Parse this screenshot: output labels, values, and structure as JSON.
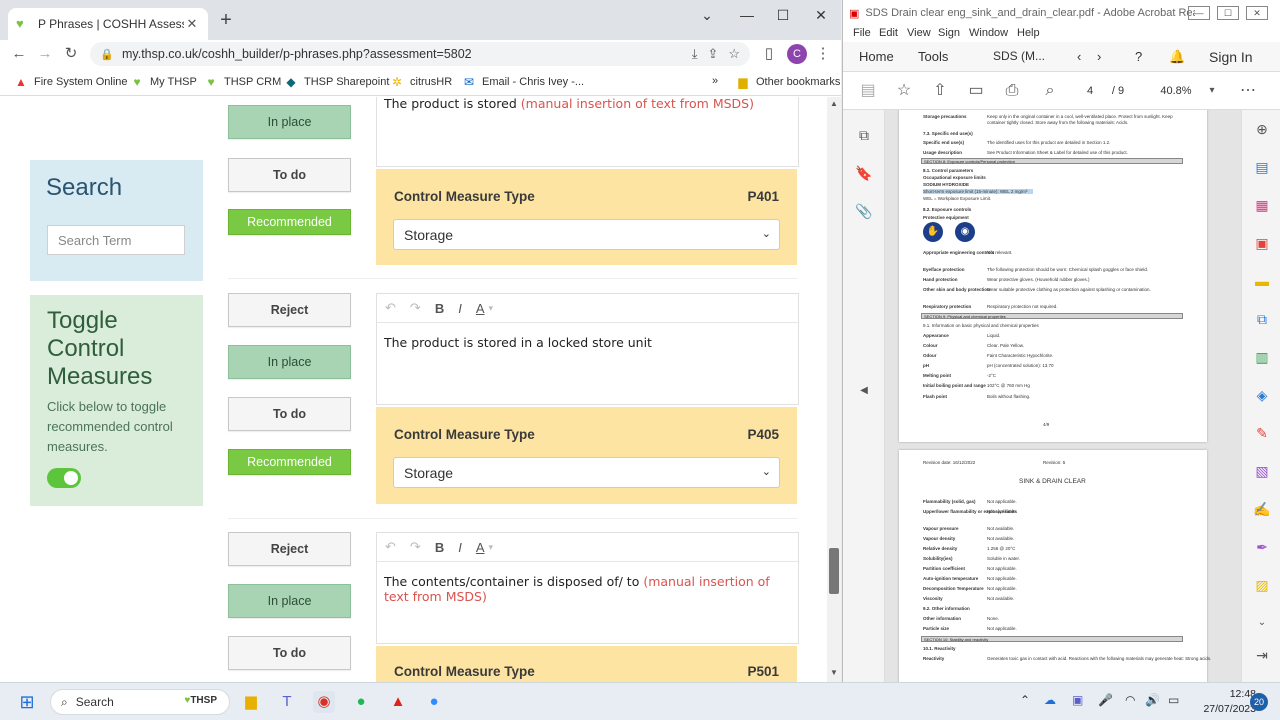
{
  "chrome": {
    "tab_title": "P Phrases | COSHH Assessment F",
    "url": "my.thsp.co.uk/coshh_builder/p-phrases.php?assessment=5802",
    "profile_initial": "C",
    "bookmarks": [
      {
        "label": "Fire System Online"
      },
      {
        "label": "My THSP"
      },
      {
        "label": "THSP CRM"
      },
      {
        "label": "THSP Sharepoint"
      },
      {
        "label": "citrusHR"
      },
      {
        "label": "Email - Chris Ivey -..."
      }
    ],
    "bookmarks_more": "»",
    "other_bookmarks": "Other bookmarks"
  },
  "sidebar": {
    "search_title": "Search",
    "search_placeholder": "Search Term",
    "toggle_title": "Toggle Control Measures",
    "toggle_desc": "Click below to toggle recommended control measures."
  },
  "buttons": {
    "reject": "Reject",
    "in_place": "In place",
    "to_do": "To do",
    "recommended": "Recommended"
  },
  "measures": [
    {
      "text_plain": "The product is stored ",
      "text_red": "(manual insertion of text from MSDS)",
      "type_label": "Control Measure Type",
      "code": "P401",
      "type_value": "Storage"
    },
    {
      "text_plain": "The product is stored in a locked store unit",
      "text_red": "",
      "type_label": "Control Measure Type",
      "code": "P405",
      "type_value": "Storage"
    },
    {
      "text_plain": "The contents/container is disposed of/ to ",
      "text_red": "(manual insertion of text from MSDS)",
      "type_label": "Control Measure Type",
      "code": "P501",
      "type_value": ""
    }
  ],
  "acrobat": {
    "title": "SDS Drain clear eng_sink_and_drain_clear.pdf - Adobe Acrobat Reader (...",
    "menu": [
      "File",
      "Edit",
      "View",
      "Sign",
      "Window",
      "Help"
    ],
    "nav": {
      "home": "Home",
      "tools": "Tools",
      "doc_tab": "SDS (M...",
      "sign_in": "Sign In"
    },
    "page_current": "4",
    "page_total": "/ 9",
    "zoom": "40.8%",
    "page1_rows": [
      {
        "k": "Storage precautions",
        "v": "Keep only in the original container in a cool, well-ventilated place. Protect from sunlight. Keep"
      },
      {
        "k": "",
        "v": "container tightly closed. Store away from the following materials: Acids."
      },
      {
        "k": "7.3. Specific end use(s)",
        "v": ""
      },
      {
        "k": "Specific end use(s)",
        "v": "The identified uses for this product are detailed in Section 1.2."
      },
      {
        "k": "Usage description",
        "v": "See Product Information Sheet & Label for detailed use of this product."
      }
    ],
    "section8": "SECTION 8: Exposure controls/Personal protection",
    "page1_rows2": [
      {
        "k": "8.1. Control parameters",
        "v": ""
      },
      {
        "k": "Occupational exposure limits",
        "v": ""
      },
      {
        "k": "SODIUM HYDROXIDE",
        "v": ""
      },
      {
        "k": "Short-term exposure limit (15-minute): WEL 2 mg/m³",
        "v": ""
      },
      {
        "k": "WEL = Workplace Exposure Limit.",
        "v": ""
      },
      {
        "k": "8.2. Exposure controls",
        "v": ""
      },
      {
        "k": "Protective equipment",
        "v": ""
      }
    ],
    "page1_rows3": [
      {
        "k": "Appropriate engineering controls",
        "v": "Not relevant."
      },
      {
        "k": "Eye/face protection",
        "v": "The following protection should be worn: Chemical splash goggles or face shield."
      },
      {
        "k": "Hand protection",
        "v": "Wear protective gloves. (Household rubber gloves.)"
      },
      {
        "k": "Other skin and body protection",
        "v": "Wear suitable protective clothing as protection against splashing or contamination."
      },
      {
        "k": "Respiratory protection",
        "v": "Respiratory protection not required."
      }
    ],
    "section9": "SECTION 9: Physical and chemical properties",
    "page1_rows4": [
      {
        "k": "9.1. Information on basic physical and chemical properties",
        "v": ""
      },
      {
        "k": "Appearance",
        "v": "Liquid."
      },
      {
        "k": "Colour",
        "v": "Clear. Pale Yellow."
      },
      {
        "k": "Odour",
        "v": "Faint Characteristic Hypochlorite."
      },
      {
        "k": "pH",
        "v": "pH (concentrated solution): 13.70"
      },
      {
        "k": "Melting point",
        "v": "-2°C"
      },
      {
        "k": "Initial boiling point and range",
        "v": "102°C @ 760 mm Hg"
      },
      {
        "k": "Flash point",
        "v": "Boils without flashing."
      }
    ],
    "page1_footer": "4/9",
    "page2_header_left": "Revision date: 16/12/2022",
    "page2_header_right": "Revision: 5",
    "page2_title": "SINK & DRAIN CLEAR",
    "page2_rows": [
      {
        "k": "Flammability (solid, gas)",
        "v": "Not applicable."
      },
      {
        "k": "Upper/lower flammability or explosive limits",
        "v": "Not applicable."
      },
      {
        "k": "Vapour pressure",
        "v": "Not available."
      },
      {
        "k": "Vapour density",
        "v": "Not available."
      },
      {
        "k": "Relative density",
        "v": "1.256 @ 20°C"
      },
      {
        "k": "Solubility(ies)",
        "v": "Soluble in water."
      },
      {
        "k": "Partition coefficient",
        "v": "Not applicable."
      },
      {
        "k": "Auto-ignition temperature",
        "v": "Not applicable."
      },
      {
        "k": "Decomposition Temperature",
        "v": "Not applicable."
      },
      {
        "k": "Viscosity",
        "v": "Not available."
      },
      {
        "k": "9.2. Other information",
        "v": ""
      },
      {
        "k": "Other information",
        "v": "None."
      },
      {
        "k": "Particle size",
        "v": "Not applicable."
      }
    ],
    "section10": "SECTION 10: Stability and reactivity",
    "page2_rows2": [
      {
        "k": "10.1. Reactivity",
        "v": ""
      },
      {
        "k": "Reactivity",
        "v": "Generates toxic gas in contact with acid. Reactions with the following materials may generate heat: Strong acids."
      }
    ]
  },
  "taskbar": {
    "search": "Search",
    "search_badge": "THSP",
    "time": "12:48",
    "date": "27/07/2023",
    "notifications": "20"
  }
}
